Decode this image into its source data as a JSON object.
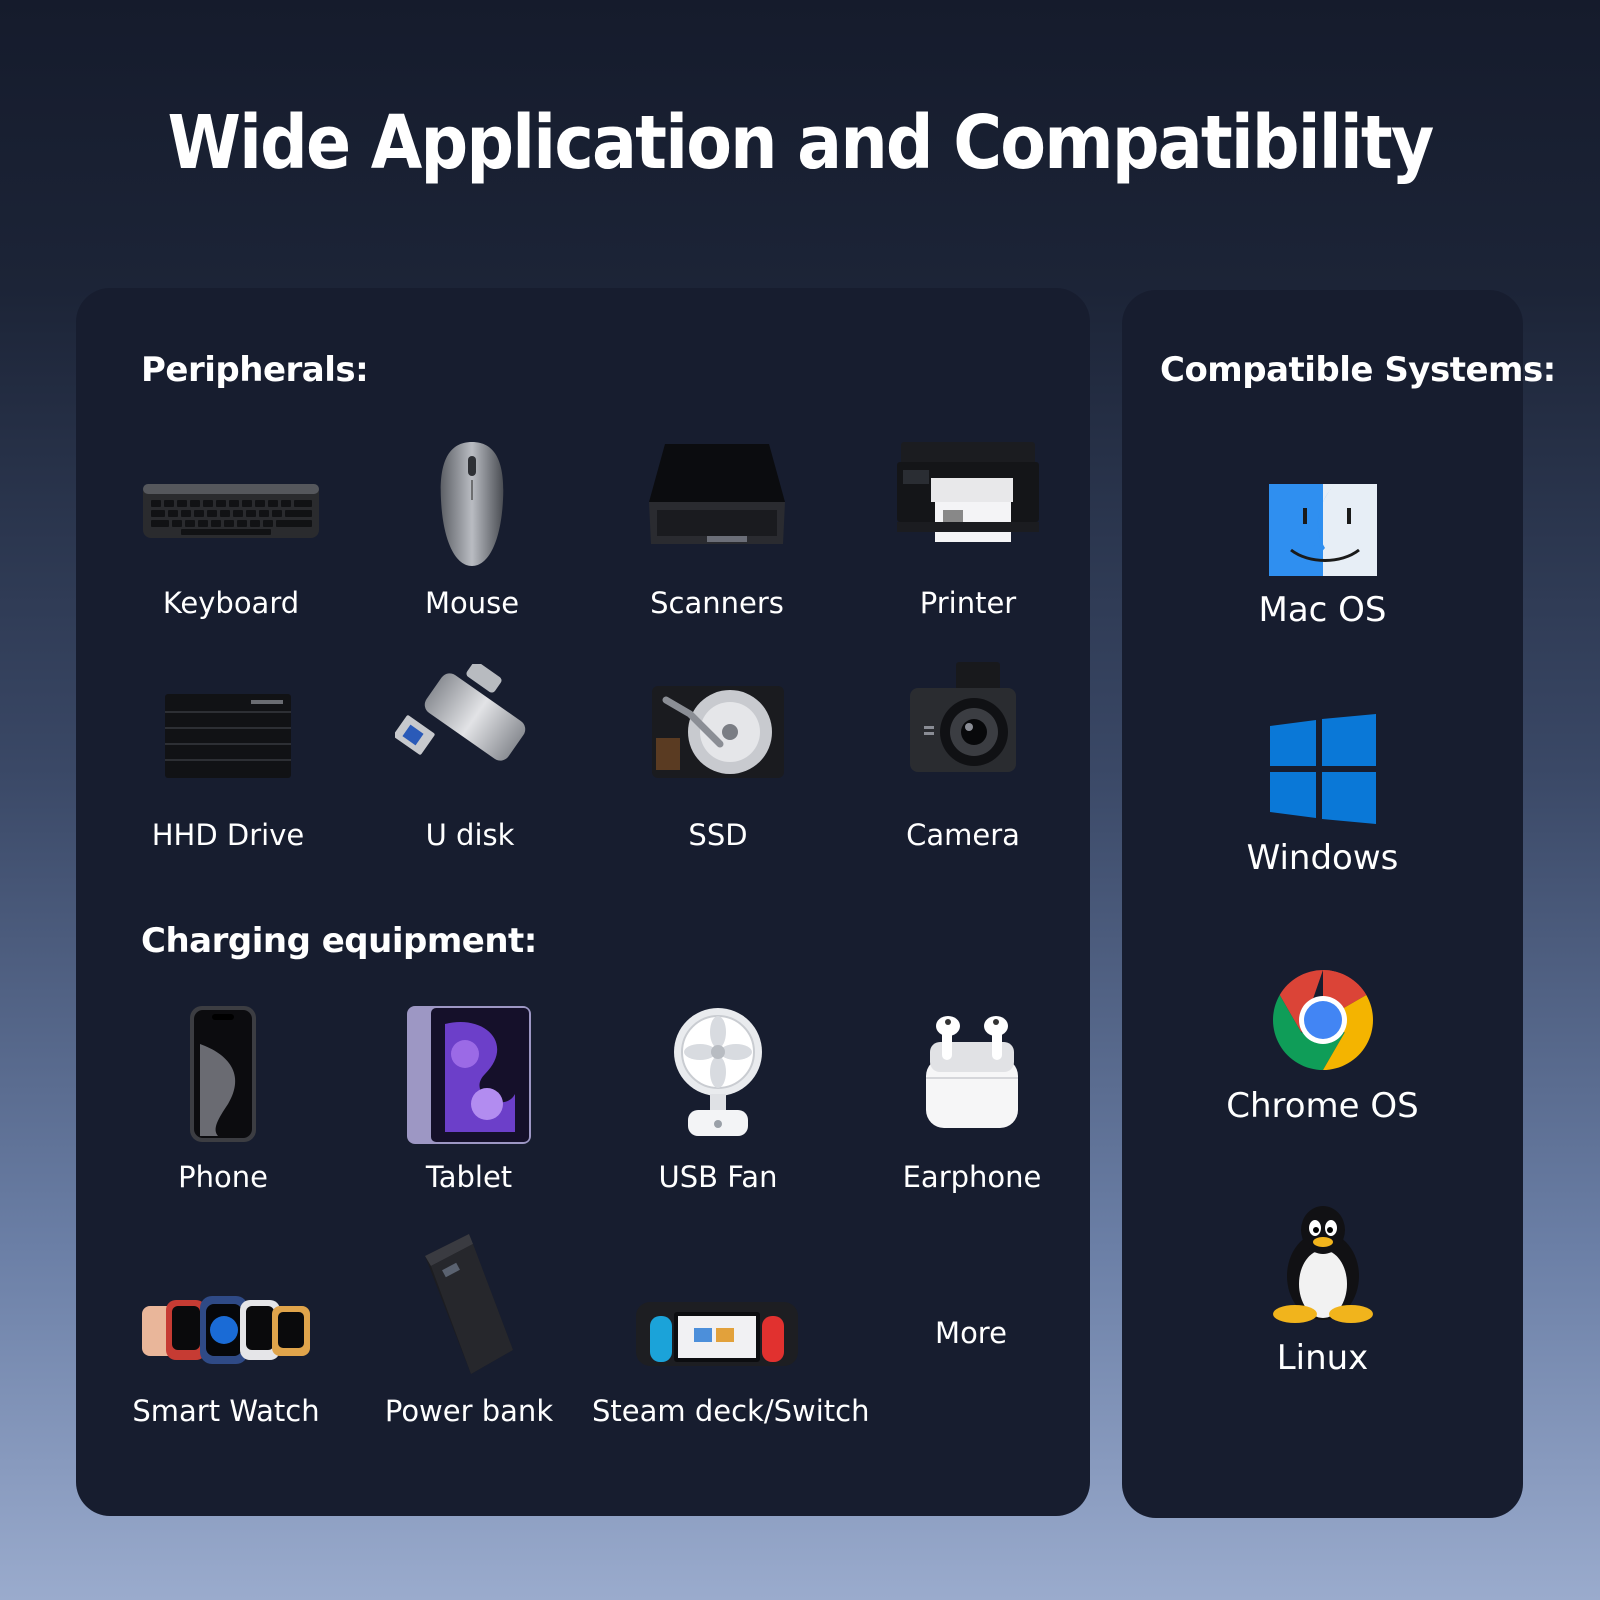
{
  "title": "Wide Application and Compatibility",
  "peripherals": {
    "heading": "Peripherals:",
    "items": [
      {
        "label": "Keyboard",
        "icon": "keyboard-icon"
      },
      {
        "label": "Mouse",
        "icon": "mouse-icon"
      },
      {
        "label": "Scanners",
        "icon": "scanner-icon"
      },
      {
        "label": "Printer",
        "icon": "printer-icon"
      },
      {
        "label": "HHD Drive",
        "icon": "hhd-drive-icon"
      },
      {
        "label": "U disk",
        "icon": "usb-disk-icon"
      },
      {
        "label": "SSD",
        "icon": "ssd-icon"
      },
      {
        "label": "Camera",
        "icon": "camera-icon"
      }
    ]
  },
  "charging": {
    "heading": "Charging equipment:",
    "items": [
      {
        "label": "Phone",
        "icon": "phone-icon"
      },
      {
        "label": "Tablet",
        "icon": "tablet-icon"
      },
      {
        "label": "USB Fan",
        "icon": "usb-fan-icon"
      },
      {
        "label": "Earphone",
        "icon": "earphone-icon"
      },
      {
        "label": "Smart Watch",
        "icon": "smart-watch-icon"
      },
      {
        "label": "Power bank",
        "icon": "power-bank-icon"
      },
      {
        "label": "Steam deck/Switch",
        "icon": "game-console-icon"
      },
      {
        "label": "More",
        "icon": ""
      }
    ]
  },
  "systems": {
    "heading": "Compatible Systems:",
    "items": [
      {
        "label": "Mac OS",
        "icon": "mac-finder-icon"
      },
      {
        "label": "Windows",
        "icon": "windows-logo-icon"
      },
      {
        "label": "Chrome OS",
        "icon": "chrome-logo-icon"
      },
      {
        "label": "Linux",
        "icon": "linux-tux-icon"
      }
    ]
  },
  "colors": {
    "panel": "#171d2f",
    "text": "#ffffff",
    "mac_blue": "#2f8ff0",
    "windows_blue": "#0a78d7",
    "chrome_red": "#db4437",
    "chrome_yellow": "#f4b400",
    "chrome_green": "#0f9d58",
    "chrome_blue": "#4285f4"
  }
}
